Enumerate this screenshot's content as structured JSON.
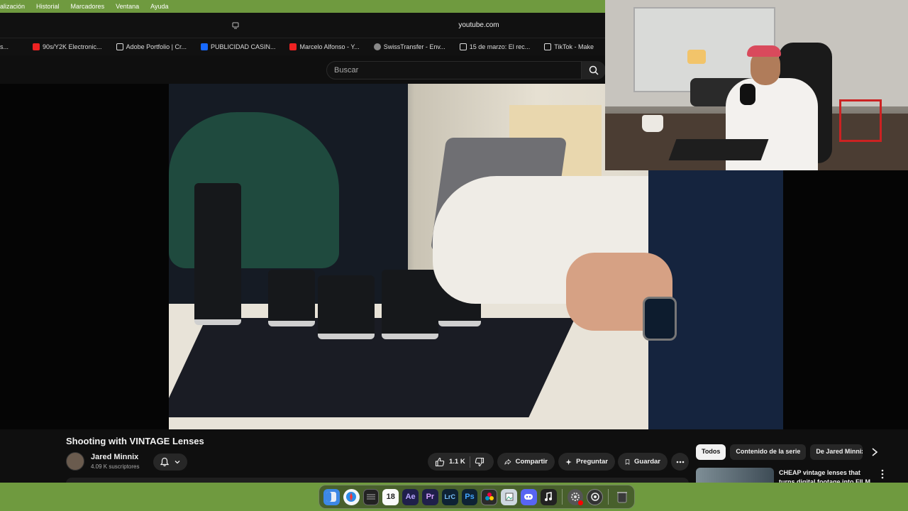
{
  "menubar": {
    "items": [
      "alización",
      "Historial",
      "Marcadores",
      "Ventana",
      "Ayuda"
    ]
  },
  "browser": {
    "url": "youtube.com",
    "bookmarks": [
      {
        "label": "s...",
        "icon": "none"
      },
      {
        "label": "90s/Y2K Electronic...",
        "icon": "youtube-icon"
      },
      {
        "label": "Adobe Portfolio | Cr...",
        "icon": "portfolio-icon"
      },
      {
        "label": "PUBLICIDAD CASIN...",
        "icon": "behance-icon"
      },
      {
        "label": "Marcelo Alfonso - Y...",
        "icon": "youtube-icon"
      },
      {
        "label": "SwissTransfer - Env...",
        "icon": "swisstransfer-icon"
      },
      {
        "label": "15 de marzo: El rec...",
        "icon": "tiktok-icon"
      },
      {
        "label": "TikTok - Make",
        "icon": "tiktok-icon"
      }
    ]
  },
  "youtube": {
    "search_placeholder": "Buscar",
    "video": {
      "title": "Shooting with VINTAGE Lenses",
      "channel": "Jared Minnix",
      "subscribers": "4.09 K suscriptores",
      "likes": "1.1 K",
      "share_label": "Compartir",
      "ask_label": "Preguntar",
      "save_label": "Guardar"
    },
    "chips": [
      "Todos",
      "Contenido de la serie",
      "De Jared Minnix"
    ],
    "recommendation": {
      "title": "CHEAP vintage lenses that turns digital footage into FILM"
    }
  },
  "dock": {
    "calendar_day": "18",
    "apps": [
      "Ae",
      "Pr",
      "LrC",
      "Ps"
    ]
  },
  "colors": {
    "desktop_green": "#6f9a3f",
    "youtube_bg": "#0f0f0f",
    "button_bg": "#272727",
    "youtube_red": "#ff0000"
  }
}
